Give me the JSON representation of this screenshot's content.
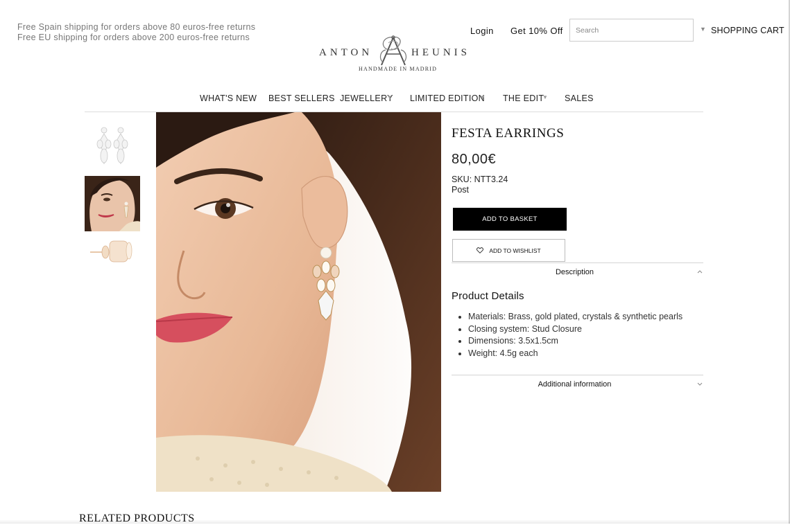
{
  "header": {
    "shipping_line_1": "Free Spain shipping for orders above 80 euros-free returns",
    "shipping_line_2": "Free EU shipping for orders above 200 euros-free returns",
    "logo": {
      "brand_left": "ANTON",
      "brand_right": "HEUNIS",
      "tagline": "HANDMADE IN MADRID"
    },
    "login_label": "Login",
    "promo_label": "Get 10% Off",
    "search_placeholder": "Search",
    "cart_label": "SHOPPING CART"
  },
  "nav": {
    "items": [
      {
        "label": "WHAT'S NEW",
        "has_dropdown": false
      },
      {
        "label": "BEST SELLERS",
        "has_dropdown": false
      },
      {
        "label": "JEWELLERY",
        "has_dropdown": true
      },
      {
        "label": "LIMITED EDITION",
        "has_dropdown": true
      },
      {
        "label": "THE EDIT",
        "has_dropdown": true
      },
      {
        "label": "SALES",
        "has_dropdown": false
      }
    ]
  },
  "gallery": {
    "thumbnails": [
      "earrings-product-shot",
      "model-wearing-earring",
      "earring-side-view"
    ],
    "main_image": "model-wearing-earring"
  },
  "product": {
    "title": "FESTA EARRINGS",
    "price": "80,00€",
    "sku": "SKU: NTT3.24",
    "shipping_method": "Post",
    "add_to_basket_label": "ADD TO BASKET",
    "add_to_wishlist_label": "ADD TO WISHLIST"
  },
  "description": {
    "label": "Description",
    "expanded": true,
    "details_title": "Product Details",
    "details": [
      "Materials: Brass, gold plated, crystals & synthetic pearls",
      "Closing system: Stud Closure",
      "Dimensions: 3.5x1.5cm",
      "Weight: 4.5g each"
    ]
  },
  "additional_info": {
    "label": "Additional information",
    "expanded": false
  },
  "related": {
    "title": "RELATED PRODUCTS"
  },
  "colors": {
    "button_dark": "#000000",
    "text": "#1a1a1a",
    "muted_text": "#777777",
    "divider": "#d4d4d4"
  }
}
